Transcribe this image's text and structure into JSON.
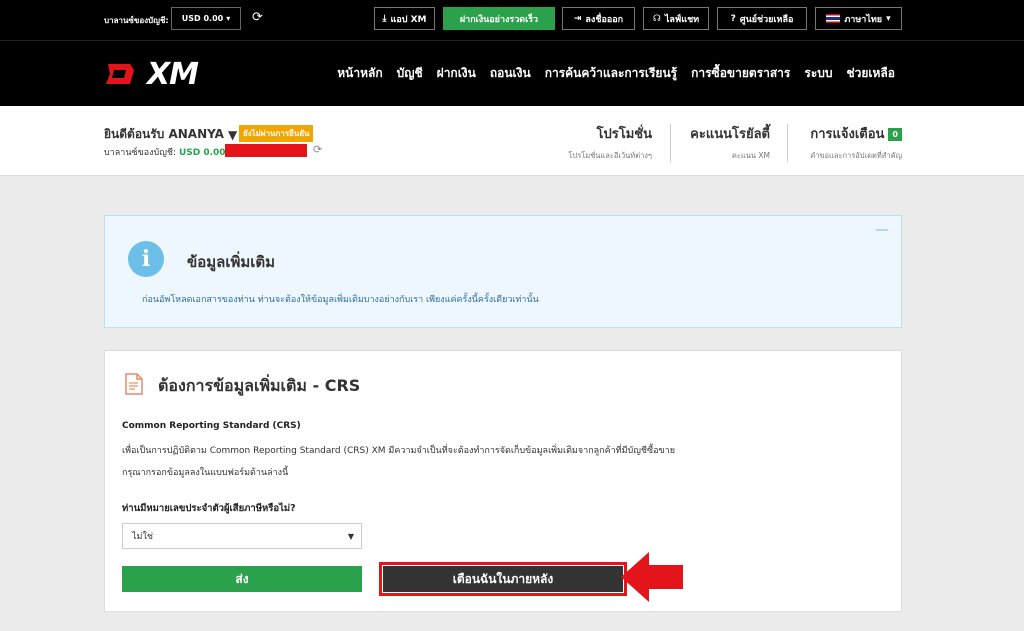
{
  "topbar": {
    "balance_label": "บาลานซ์ของบัญชี:",
    "balance_value": "USD 0.00",
    "buttons": [
      {
        "label": "แอป XM",
        "icon": "download-icon"
      },
      {
        "label": "ฝากเงินอย่างรวดเร็ว",
        "icon": ""
      },
      {
        "label": "ลงชื่อออก",
        "icon": "logout-icon"
      },
      {
        "label": "ไลฟ์แชท",
        "icon": "headset-icon"
      },
      {
        "label": "ศูนย์ช่วยเหลือ",
        "icon": "help-icon"
      },
      {
        "label": "ภาษาไทย",
        "icon": "thai-flag-icon"
      }
    ]
  },
  "header": {
    "logo_text": "XM",
    "nav": [
      "หน้าหลัก",
      "บัญชี",
      "ฝากเงิน",
      "ถอนเงิน",
      "การค้นคว้าและการเรียนรู้",
      "การซื้อขายตราสาร",
      "ระบบ",
      "ช่วยเหลือ"
    ]
  },
  "welcome": {
    "greeting": "ยินดีต้อนรับ ANANYA",
    "badge": "ยังไม่ผ่านการยืนยัน",
    "balance_label": "บาลานซ์ของบัญชี:",
    "balance_value": "USD 0.00",
    "promos_title": "โปรโมชั่น",
    "promos_sub": "โปรโมชั่นและอีเว้นท์ต่างๆ",
    "loyalty_title": "คะแนนโรยัลตี้",
    "loyalty_sub": "คะแนน XM",
    "notif_title": "การแจ้งเตือน",
    "notif_count": "0",
    "notif_sub": "คำขอและการอัปเดตที่สำคัญ"
  },
  "info": {
    "title": "ข้อมูลเพิ่มเติม",
    "text": "ก่อนอัพโหลดเอกสารของท่าน ท่านจะต้องให้ข้อมูลเพิ่มเติมบางอย่างกับเรา เพียงแค่ครั้งนี้ครั้งเดียวเท่านั้น",
    "collapse": "—"
  },
  "crs": {
    "title": "ต้องการข้อมูลเพิ่มเติม - CRS",
    "heading": "Common Reporting Standard (CRS)",
    "para1": "เพื่อเป็นการปฏิบัติตาม Common Reporting Standard (CRS) XM มีความจำเป็นที่จะต้องทำการจัดเก็บข้อมูลเพิ่มเติมจากลูกค้าที่มีบัญชีซื้อขาย",
    "para2": "กรุณากรอกข้อมูลลงในแบบฟอร์มด้านล่างนี้",
    "question": "ท่านมีหมายเลขประจำตัวผู้เสียภาษีหรือไม่?",
    "selected": "ไม่ใช่",
    "submit": "ส่ง",
    "remind": "เตือนฉันในภายหลัง"
  },
  "colors": {
    "green": "#2aa14a",
    "red": "#e4141b",
    "info_bg": "#eef7fd",
    "info_icon": "#6cbfe8",
    "badge": "#f0a500"
  }
}
